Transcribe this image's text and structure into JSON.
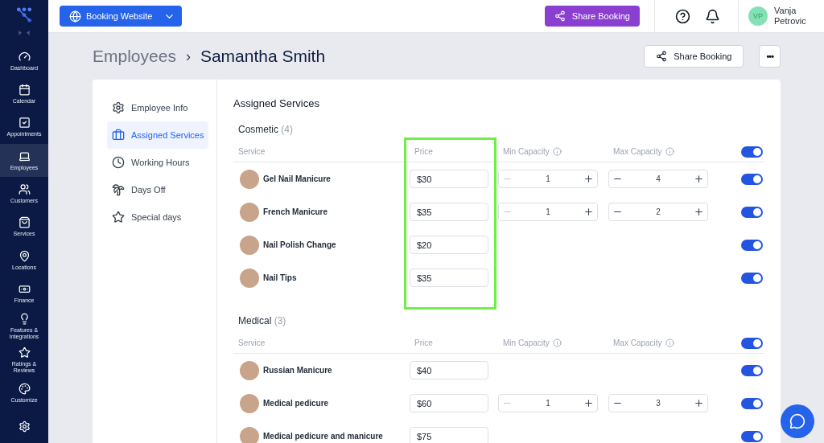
{
  "sidebar": {
    "items": [
      {
        "kind": "dashboard",
        "label": "Dashboard",
        "selected": false
      },
      {
        "kind": "calendar",
        "label": "Calendar",
        "selected": false
      },
      {
        "kind": "appointments",
        "label": "Appointments",
        "selected": false
      },
      {
        "kind": "employees",
        "label": "Employees",
        "selected": true
      },
      {
        "kind": "customers",
        "label": "Customers",
        "selected": false
      },
      {
        "kind": "services",
        "label": "Services",
        "selected": false
      },
      {
        "kind": "locations",
        "label": "Locations",
        "selected": false
      },
      {
        "kind": "finance",
        "label": "Finance",
        "selected": false
      },
      {
        "kind": "features",
        "label": "Features & Integrations",
        "selected": false
      },
      {
        "kind": "ratings",
        "label": "Ratings & Reviews",
        "selected": false
      },
      {
        "kind": "customize",
        "label": "Customize",
        "selected": false
      },
      {
        "kind": "settings",
        "selected": false
      }
    ]
  },
  "topbar": {
    "website_button": "Booking Website",
    "share_button": "Share Booking",
    "user": {
      "initials": "VP",
      "name": "Vanja Petrovic"
    }
  },
  "breadcrumb": {
    "parent": "Employees",
    "separator": "›",
    "current": "Samantha Smith"
  },
  "header_actions": {
    "share_button": "Share Booking",
    "more_button": "•••"
  },
  "employee_nav": [
    {
      "kind": "info",
      "label": "Employee Info",
      "selected": false
    },
    {
      "kind": "services",
      "label": "Assigned Services",
      "selected": true
    },
    {
      "kind": "hours",
      "label": "Working Hours",
      "selected": false
    },
    {
      "kind": "daysoff",
      "label": "Days Off",
      "selected": false
    },
    {
      "kind": "special",
      "label": "Special days",
      "selected": false
    }
  ],
  "panel_title": "Assigned Services",
  "groups": [
    {
      "name": "Cosmetic",
      "count": "(4)",
      "highlight_price": true,
      "columns": [
        "Service",
        "Price",
        "Min Capacity",
        "Max Capacity"
      ],
      "all_on": true,
      "rows": [
        {
          "name": "Gel Nail Manicure",
          "price": "$30",
          "min": {
            "value": "1",
            "minus_disabled": true
          },
          "max": {
            "value": "4",
            "minus_disabled": false
          },
          "on": true
        },
        {
          "name": "French Manicure",
          "price": "$35",
          "min": {
            "value": "1",
            "minus_disabled": true
          },
          "max": {
            "value": "2",
            "minus_disabled": false
          },
          "on": true
        },
        {
          "name": "Nail Polish Change",
          "price": "$20",
          "on": true
        },
        {
          "name": "Nail Tips",
          "price": "$35",
          "on": true
        }
      ]
    },
    {
      "name": "Medical",
      "count": "(3)",
      "columns": [
        "Service",
        "Price",
        "Min Capacity",
        "Max Capacity"
      ],
      "all_on": true,
      "rows": [
        {
          "name": "Russian Manicure",
          "price": "$40",
          "on": true
        },
        {
          "name": "Medical pedicure",
          "price": "$60",
          "min": {
            "value": "1",
            "minus_disabled": true
          },
          "max": {
            "value": "3",
            "minus_disabled": false
          },
          "on": true
        },
        {
          "name": "Medical pedicure and manicure",
          "price": "$75",
          "on": true
        }
      ]
    }
  ]
}
